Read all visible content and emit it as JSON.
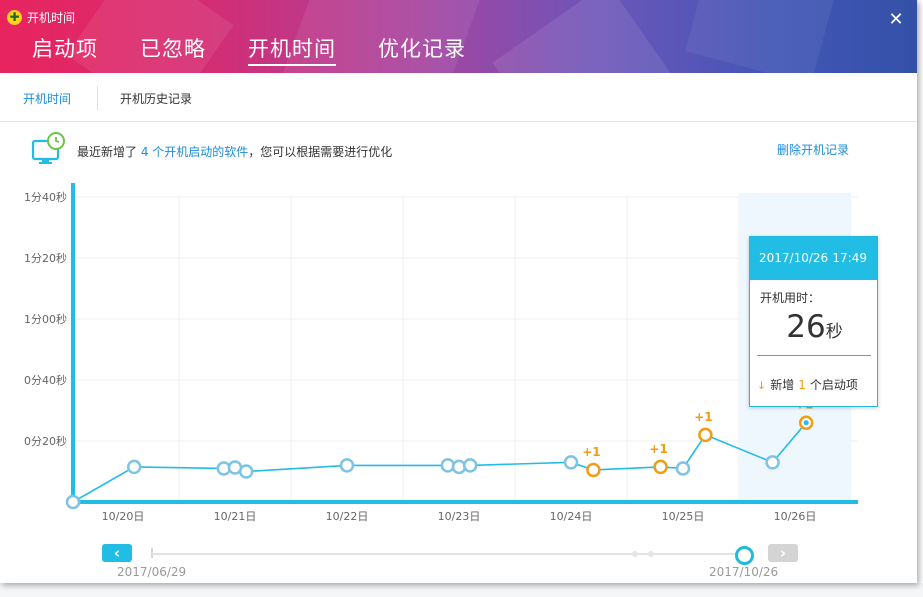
{
  "window": {
    "title": "开机时间",
    "close_symbol": "✕"
  },
  "main_tabs": [
    {
      "label": "启动项",
      "active": false
    },
    {
      "label": "已忽略",
      "active": false
    },
    {
      "label": "开机时间",
      "active": true
    },
    {
      "label": "优化记录",
      "active": false
    }
  ],
  "sub_tabs": [
    {
      "label": "开机时间",
      "active": true
    },
    {
      "label": "开机历史记录",
      "active": false
    }
  ],
  "notice": {
    "prefix": "最近新增了",
    "highlight": "4 个开机启动的软件",
    "suffix": "，您可以根据需要进行优化",
    "delete_link": "删除开机记录"
  },
  "chart_data": {
    "type": "line",
    "y_unit": "seconds",
    "ylim": [
      0,
      100
    ],
    "y_ticks": [
      {
        "value": 20,
        "label": "0分20秒"
      },
      {
        "value": 40,
        "label": "0分40秒"
      },
      {
        "value": 60,
        "label": "1分00秒"
      },
      {
        "value": 80,
        "label": "1分20秒"
      },
      {
        "value": 100,
        "label": "1分40秒"
      }
    ],
    "x_ticks": [
      "10/20日",
      "10/21日",
      "10/22日",
      "10/23日",
      "10/24日",
      "10/25日",
      "10/26日"
    ],
    "points": [
      {
        "day": 0.0,
        "value": 0,
        "added": null
      },
      {
        "day": 0.1,
        "value": 11.5,
        "added": null
      },
      {
        "day": 0.9,
        "value": 11,
        "added": null
      },
      {
        "day": 1.0,
        "value": 11.3,
        "added": null
      },
      {
        "day": 1.1,
        "value": 10,
        "added": null
      },
      {
        "day": 2.0,
        "value": 12,
        "added": null
      },
      {
        "day": 2.9,
        "value": 12,
        "added": null
      },
      {
        "day": 3.0,
        "value": 11.5,
        "added": null
      },
      {
        "day": 3.1,
        "value": 12,
        "added": null
      },
      {
        "day": 4.0,
        "value": 13,
        "added": null
      },
      {
        "day": 4.2,
        "value": 10.5,
        "added": 1
      },
      {
        "day": 4.8,
        "value": 11.5,
        "added": 1
      },
      {
        "day": 5.0,
        "value": 11,
        "added": null
      },
      {
        "day": 5.2,
        "value": 22,
        "added": 1
      },
      {
        "day": 5.8,
        "value": 13,
        "added": null
      },
      {
        "day": 6.1,
        "value": 26,
        "added": 1
      }
    ],
    "added_label_prefix": "+",
    "highlight_day": 6,
    "colors": {
      "line": "#22bde4",
      "normal_point": "#7ec3e6",
      "added_point": "#f39c12",
      "axis": "#22bde4",
      "highlight": "#eef7fd"
    }
  },
  "tooltip": {
    "date": "2017/10/26",
    "time": "17:49",
    "label": "开机用时：",
    "value": "26",
    "unit": "秒",
    "arrow": "↓",
    "added_prefix": "新增",
    "added_count": "1",
    "added_suffix": "个启动项"
  },
  "timeline": {
    "prev_symbol": "‹",
    "next_symbol": "›",
    "start_date": "2017/06/29",
    "end_date": "2017/10/26",
    "position": 1.0
  },
  "colors": {
    "accent": "#1a8fd6",
    "brand_cyan": "#22bde4",
    "orange": "#f39c12"
  }
}
